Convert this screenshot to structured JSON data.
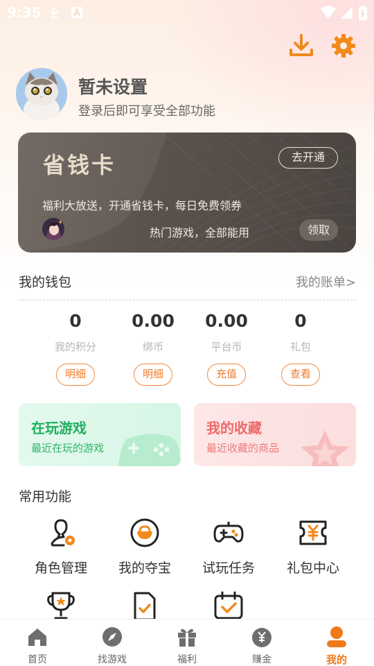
{
  "status_bar": {
    "time": "9:35"
  },
  "profile": {
    "name": "暂未设置",
    "subtitle": "登录后即可享受全部功能"
  },
  "savings_card": {
    "title": "省钱卡",
    "open_button": "去开通",
    "description": "福利大放送，开通省钱卡，每日免费领券",
    "hot_text": "热门游戏，全部能用",
    "claim_button": "领取"
  },
  "wallet": {
    "title": "我的钱包",
    "bill_link": "我的账单>",
    "items": [
      {
        "value": "0",
        "label": "我的积分",
        "button": "明细"
      },
      {
        "value": "0.00",
        "label": "绑币",
        "button": "明细"
      },
      {
        "value": "0.00",
        "label": "平台币",
        "button": "充值"
      },
      {
        "value": "0",
        "label": "礼包",
        "button": "查看"
      }
    ]
  },
  "shortcuts": {
    "playing": {
      "title": "在玩游戏",
      "subtitle": "最近在玩的游戏"
    },
    "favorites": {
      "title": "我的收藏",
      "subtitle": "最近收藏的商品"
    }
  },
  "functions": {
    "title": "常用功能",
    "items": [
      {
        "label": "角色管理",
        "icon": "role-icon"
      },
      {
        "label": "我的夺宝",
        "icon": "treasure-icon"
      },
      {
        "label": "试玩任务",
        "icon": "gamepad-icon"
      },
      {
        "label": "礼包中心",
        "icon": "ticket-icon"
      },
      {
        "label": "",
        "icon": "trophy-icon"
      },
      {
        "label": "",
        "icon": "document-check-icon"
      },
      {
        "label": "",
        "icon": "calendar-check-icon"
      }
    ]
  },
  "bottom_nav": [
    {
      "label": "首页",
      "icon": "home-icon"
    },
    {
      "label": "找游戏",
      "icon": "compass-icon"
    },
    {
      "label": "福利",
      "icon": "gift-icon"
    },
    {
      "label": "赚金",
      "icon": "money-bag-icon"
    },
    {
      "label": "我的",
      "icon": "user-icon",
      "active": true
    }
  ],
  "colors": {
    "accent": "#f07a1a",
    "green_text": "#1fae5e",
    "pink_text": "#ee6a6a"
  }
}
